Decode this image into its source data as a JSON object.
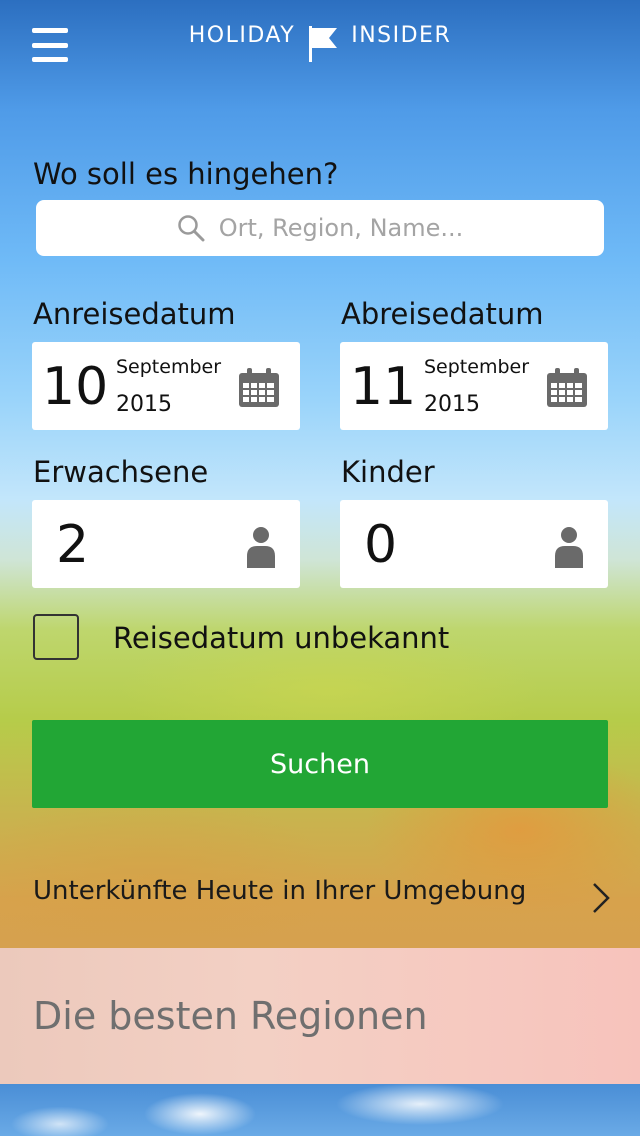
{
  "header": {
    "brand_left": "HOLIDAY",
    "brand_right": "INSIDER",
    "menu_icon": "hamburger-menu-icon",
    "logo_icon": "flag-icon"
  },
  "search": {
    "label": "Wo soll es hingehen?",
    "placeholder": "Ort, Region, Name...",
    "value": "",
    "icon": "search-icon"
  },
  "arrival": {
    "label": "Anreisedatum",
    "day": "10",
    "month": "September",
    "year": "2015",
    "icon": "calendar-icon"
  },
  "departure": {
    "label": "Abreisedatum",
    "day": "11",
    "month": "September",
    "year": "2015",
    "icon": "calendar-icon"
  },
  "adults": {
    "label": "Erwachsene",
    "value": "2",
    "icon": "person-icon"
  },
  "children": {
    "label": "Kinder",
    "value": "0",
    "icon": "person-icon"
  },
  "unknown_date": {
    "label": "Reisedatum unbekannt",
    "checked": false
  },
  "actions": {
    "search_label": "Suchen"
  },
  "nearby": {
    "label": "Unterkünfte Heute in Ihrer Umgebung",
    "icon": "chevron-right-icon"
  },
  "regions": {
    "title": "Die besten Regionen"
  },
  "colors": {
    "search_button": "#22a635",
    "regions_panel": "#f3cdc2",
    "header_top": "#2c6fc0"
  }
}
